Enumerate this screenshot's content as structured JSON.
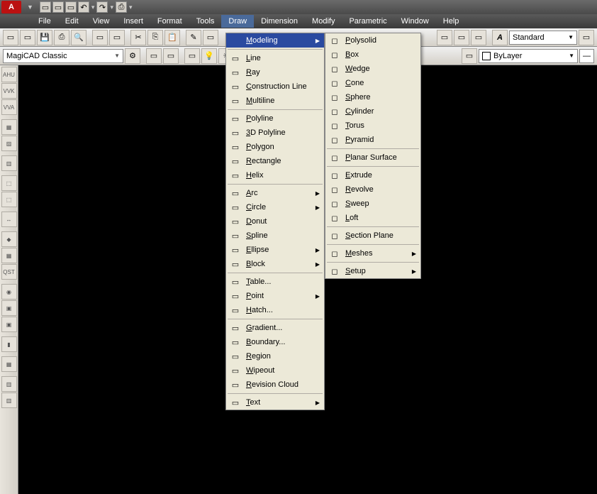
{
  "menubar": {
    "items": [
      "File",
      "Edit",
      "View",
      "Insert",
      "Format",
      "Tools",
      "Draw",
      "Dimension",
      "Modify",
      "Parametric",
      "Window",
      "Help"
    ],
    "active": "Draw"
  },
  "toolbar2": {
    "layer_combo": "MagiCAD Classic"
  },
  "toolbar1_right": {
    "style_combo": "Standard",
    "layer_combo2": "ByLayer"
  },
  "draw_menu": {
    "items": [
      {
        "label": "Modeling",
        "sub": true,
        "hl": true
      },
      {
        "divider": true
      },
      {
        "label": "Line"
      },
      {
        "label": "Ray"
      },
      {
        "label": "Construction Line"
      },
      {
        "label": "Multiline"
      },
      {
        "divider": true
      },
      {
        "label": "Polyline"
      },
      {
        "label": "3D Polyline"
      },
      {
        "label": "Polygon"
      },
      {
        "label": "Rectangle"
      },
      {
        "label": "Helix"
      },
      {
        "divider": true
      },
      {
        "label": "Arc",
        "sub": true
      },
      {
        "label": "Circle",
        "sub": true
      },
      {
        "label": "Donut"
      },
      {
        "label": "Spline"
      },
      {
        "label": "Ellipse",
        "sub": true
      },
      {
        "label": "Block",
        "sub": true
      },
      {
        "divider": true
      },
      {
        "label": "Table..."
      },
      {
        "label": "Point",
        "sub": true
      },
      {
        "label": "Hatch..."
      },
      {
        "divider": true
      },
      {
        "label": "Gradient..."
      },
      {
        "label": "Boundary..."
      },
      {
        "label": "Region"
      },
      {
        "label": "Wipeout"
      },
      {
        "label": "Revision Cloud"
      },
      {
        "divider": true
      },
      {
        "label": "Text",
        "sub": true
      }
    ]
  },
  "modeling_menu": {
    "items": [
      {
        "label": "Polysolid"
      },
      {
        "label": "Box"
      },
      {
        "label": "Wedge"
      },
      {
        "label": "Cone"
      },
      {
        "label": "Sphere"
      },
      {
        "label": "Cylinder"
      },
      {
        "label": "Torus"
      },
      {
        "label": "Pyramid"
      },
      {
        "divider": true
      },
      {
        "label": "Planar Surface"
      },
      {
        "divider": true
      },
      {
        "label": "Extrude"
      },
      {
        "label": "Revolve"
      },
      {
        "label": "Sweep"
      },
      {
        "label": "Loft"
      },
      {
        "divider": true
      },
      {
        "label": "Section Plane"
      },
      {
        "divider": true
      },
      {
        "label": "Meshes",
        "sub": true
      },
      {
        "divider": true
      },
      {
        "label": "Setup",
        "sub": true
      }
    ]
  },
  "left_tools": [
    "AHU",
    "VVK",
    "VVA",
    "",
    "▦",
    "▨",
    "",
    "▥",
    "",
    "⬚",
    "⬚",
    "",
    "↔",
    "",
    "◆",
    "▦",
    "QST",
    "",
    "◉",
    "▣",
    "▣",
    "",
    "▮",
    "",
    "▦",
    "",
    "▥",
    "▥"
  ],
  "app_logo_text": "A"
}
